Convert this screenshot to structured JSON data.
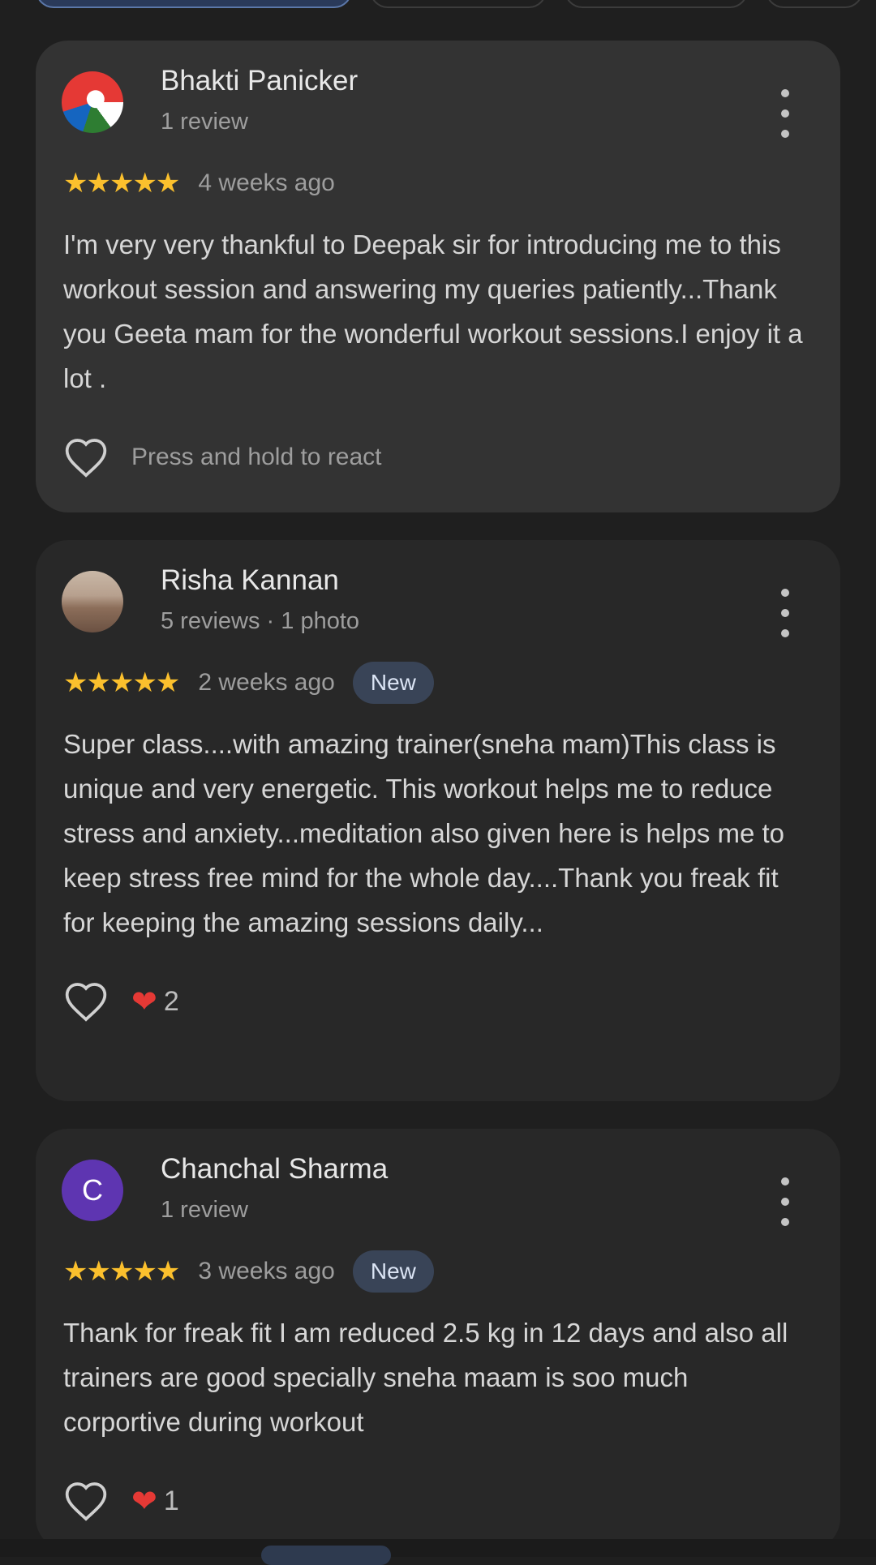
{
  "reviews": [
    {
      "name": "Bhakti Panicker",
      "sub": "1 review",
      "stars": "★★★★★",
      "time": "4 weeks ago",
      "badge": "",
      "text": "I'm very very thankful to Deepak sir for introducing me to this workout session and answering my queries patiently...Thank you Geeta mam for the wonderful workout sessions.I enjoy it a lot .",
      "react_label": "Press and hold to react",
      "avatar": "unicorn-avatar"
    },
    {
      "name": "Risha Kannan",
      "sub": "5 reviews · 1 photo",
      "stars": "★★★★★",
      "time": "2 weeks ago",
      "badge": "New",
      "text": "Super class....with amazing trainer(sneha mam)This class is unique and very energetic. This workout helps me to reduce stress and anxiety...meditation also given here is helps me to keep stress free mind for the whole day....Thank you freak fit for keeping the amazing sessions daily...",
      "reaction_count": "2",
      "avatar": "beach-photo-avatar"
    },
    {
      "name": "Chanchal Sharma",
      "sub": "1 review",
      "stars": "★★★★★",
      "time": "3 weeks ago",
      "badge": "New",
      "text": "Thank for freak fit I am reduced 2.5 kg in 12 days and also all trainers are good specially sneha maam is soo much corportive during workout",
      "reaction_count": "1",
      "avatar_letter": "C"
    }
  ],
  "colors": {
    "background": "#1f1f1f",
    "card": "#282828",
    "star": "#fbc02d",
    "badge_bg": "#394457",
    "heart": "#e53935"
  },
  "icons": {
    "more": "more-vert-icon",
    "react": "heart-outline-icon",
    "reaction": "red-heart-icon"
  }
}
